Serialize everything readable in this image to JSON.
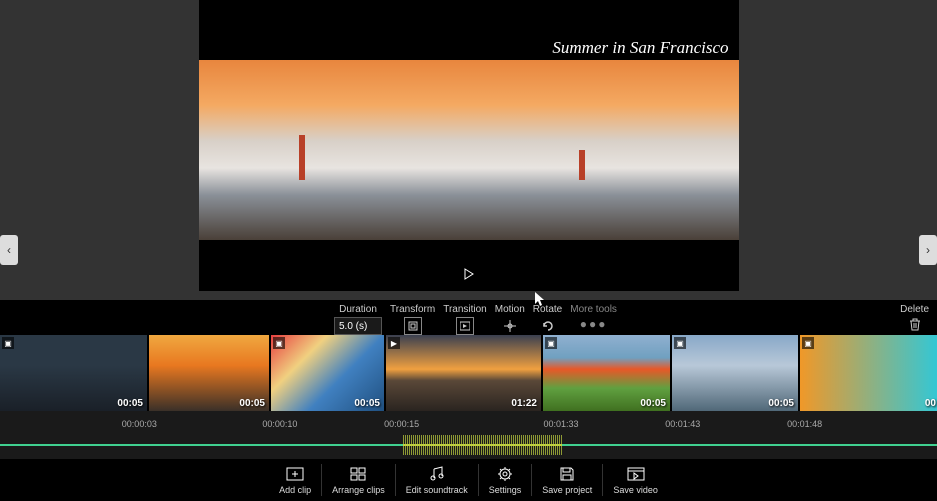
{
  "preview": {
    "title_overlay": "Summer in San Francisco"
  },
  "arrows": {
    "left": "‹",
    "right": "›"
  },
  "toolbar": {
    "duration_label": "Duration",
    "duration_value": "5.0 (s)",
    "transform_label": "Transform",
    "transition_label": "Transition",
    "motion_label": "Motion",
    "rotate_label": "Rotate",
    "more_label": "More tools",
    "delete_label": "Delete"
  },
  "clips": [
    {
      "duration": "00:05"
    },
    {
      "duration": "00:05"
    },
    {
      "duration": "00:05"
    },
    {
      "duration": "01:22"
    },
    {
      "duration": "00:05"
    },
    {
      "duration": "00:05"
    },
    {
      "duration": "00"
    }
  ],
  "timeline": {
    "marks": [
      {
        "t": "00:00:03",
        "pos": 13
      },
      {
        "t": "00:00:10",
        "pos": 28
      },
      {
        "t": "00:00:15",
        "pos": 41
      },
      {
        "t": "00:01:33",
        "pos": 58
      },
      {
        "t": "00:01:43",
        "pos": 71
      },
      {
        "t": "00:01:48",
        "pos": 84
      }
    ]
  },
  "bottom": {
    "add_clip": "Add clip",
    "arrange": "Arrange clips",
    "soundtrack": "Edit soundtrack",
    "settings": "Settings",
    "save_project": "Save project",
    "save_video": "Save video"
  }
}
